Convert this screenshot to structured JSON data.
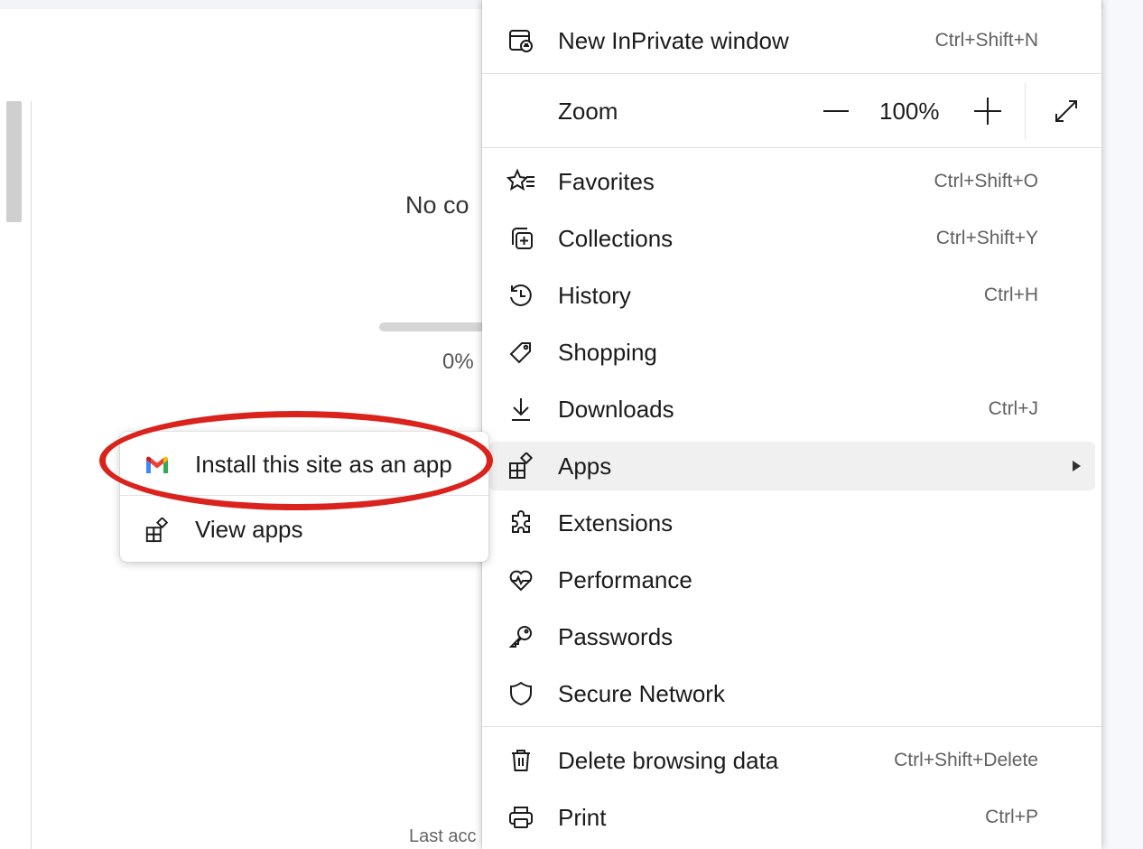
{
  "background_page": {
    "status_text": "No co",
    "progress_percent": "0%",
    "progress_fraction": 0,
    "footer_text": "Last acc"
  },
  "menu": {
    "new_inprivate": {
      "label": "New InPrivate window",
      "shortcut": "Ctrl+Shift+N",
      "icon": "inprivate-window-icon"
    },
    "zoom": {
      "label": "Zoom",
      "minus": "—",
      "value": "100%",
      "plus": "+",
      "fullscreen_icon": "fullscreen-icon"
    },
    "items": [
      {
        "label": "Favorites",
        "shortcut": "Ctrl+Shift+O",
        "icon": "favorites-icon"
      },
      {
        "label": "Collections",
        "shortcut": "Ctrl+Shift+Y",
        "icon": "collections-icon"
      },
      {
        "label": "History",
        "shortcut": "Ctrl+H",
        "icon": "history-icon"
      },
      {
        "label": "Shopping",
        "shortcut": "",
        "icon": "shopping-tag-icon"
      },
      {
        "label": "Downloads",
        "shortcut": "Ctrl+J",
        "icon": "download-icon"
      },
      {
        "label": "Apps",
        "shortcut": "",
        "icon": "apps-icon",
        "has_submenu": true,
        "hovered": true
      },
      {
        "label": "Extensions",
        "shortcut": "",
        "icon": "extensions-icon"
      },
      {
        "label": "Performance",
        "shortcut": "",
        "icon": "performance-icon"
      },
      {
        "label": "Passwords",
        "shortcut": "",
        "icon": "key-icon"
      },
      {
        "label": "Secure Network",
        "shortcut": "",
        "icon": "shield-icon"
      },
      {
        "label": "Delete browsing data",
        "shortcut": "Ctrl+Shift+Delete",
        "icon": "trash-icon"
      },
      {
        "label": "Print",
        "shortcut": "Ctrl+P",
        "icon": "printer-icon"
      }
    ]
  },
  "apps_submenu": {
    "install_label": "Install this site as an app",
    "install_icon": "gmail-icon",
    "view_apps_label": "View apps",
    "view_apps_icon": "apps-icon"
  },
  "colors": {
    "highlight_ellipse": "#d9231c",
    "gmail_red": "#ea4335",
    "gmail_blue": "#4285f4",
    "gmail_green": "#34a853",
    "gmail_yellow": "#fbbc04",
    "hover_bg": "#f0f0f0"
  }
}
